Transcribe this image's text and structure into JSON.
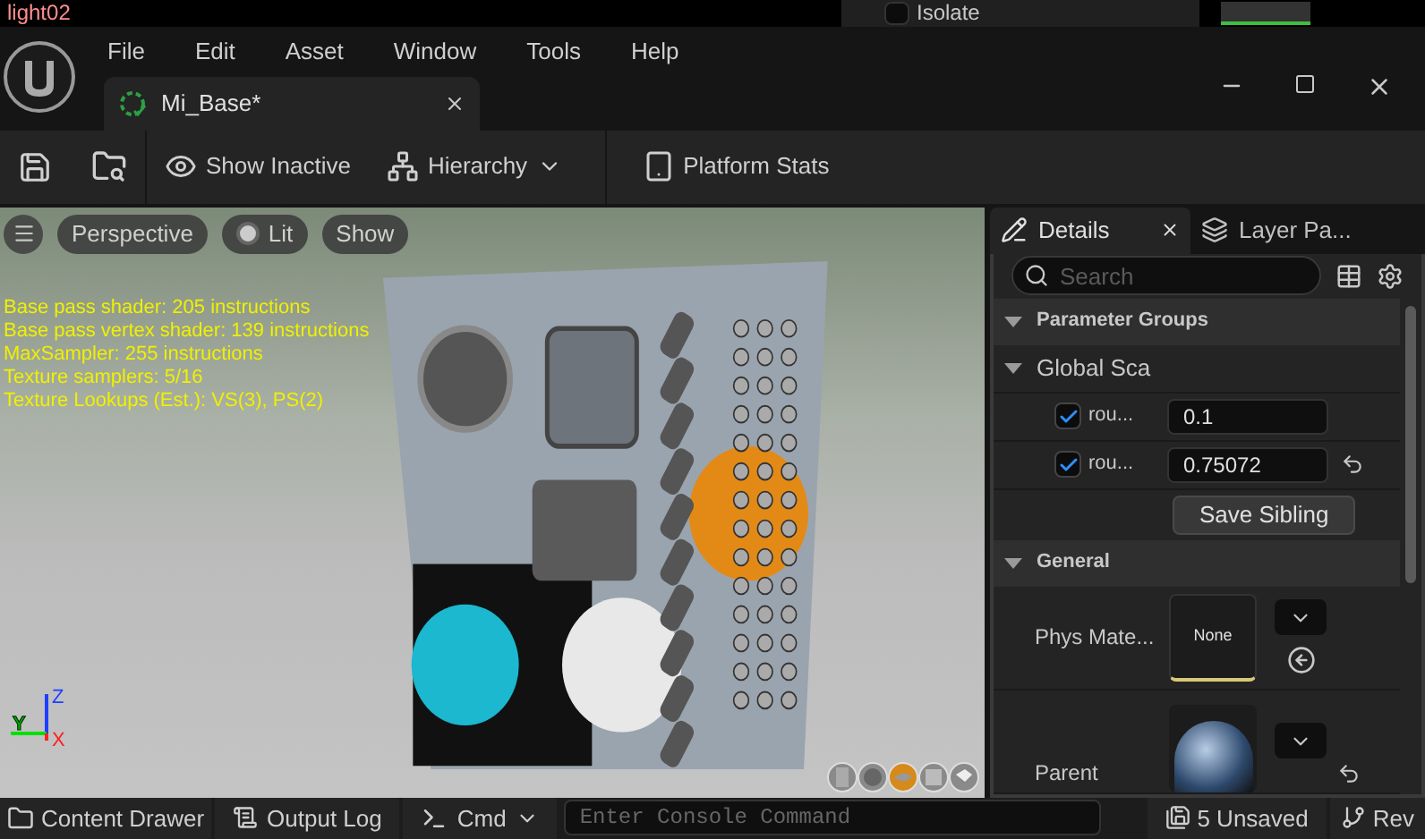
{
  "background_window": {
    "title": "light02",
    "isolate": {
      "label": "Isolate",
      "checked": false
    }
  },
  "menu": [
    "File",
    "Edit",
    "Asset",
    "Window",
    "Tools",
    "Help"
  ],
  "document_tab": {
    "label": "Mi_Base*"
  },
  "toolbar": [
    {
      "kind": "toggle",
      "label": "Show Inactive"
    },
    {
      "kind": "dropdown",
      "label": "Hierarchy"
    },
    {
      "kind": "button",
      "label": "Platform Stats"
    }
  ],
  "viewport": {
    "view_buttons": [
      {
        "kind": "view",
        "label": "Perspective"
      },
      {
        "kind": "lit",
        "label": "Lit"
      },
      {
        "kind": "view",
        "label": "Show"
      }
    ],
    "stats": [
      "Base pass shader: 205 instructions",
      "Base pass vertex shader: 139 instructions",
      "MaxSampler: 255 instructions",
      "Texture samplers: 5/16",
      "Texture Lookups (Est.): VS(3), PS(2)"
    ],
    "axes": {
      "z": "Z",
      "y": "Y",
      "x": "X"
    },
    "preview_shapes": [
      {
        "kind": "cylinder",
        "selected": false
      },
      {
        "kind": "sphere",
        "selected": false
      },
      {
        "kind": "plane",
        "selected": true
      },
      {
        "kind": "cube",
        "selected": false
      },
      {
        "kind": "mesh",
        "selected": false
      }
    ]
  },
  "details": {
    "tabs": [
      {
        "label": "Details",
        "selected": true
      },
      {
        "label": "Layer Pa...",
        "selected": false
      }
    ],
    "search": {
      "placeholder": "Search"
    },
    "parameter_groups": {
      "title": "Parameter Groups",
      "expanded": true,
      "groups": [
        {
          "title": "Global Sca",
          "expanded": true,
          "params": [
            {
              "name": "rou...",
              "checked": true,
              "value": "0.1",
              "reset": false
            },
            {
              "name": "rou...",
              "checked": true,
              "value": "0.75072",
              "reset": true
            }
          ]
        }
      ],
      "save_button": "Save Sibling"
    },
    "general": {
      "title": "General",
      "expanded": true,
      "properties": [
        {
          "kind": "asset",
          "name": "Phys Mate...",
          "asset": "None",
          "reset": false
        },
        {
          "kind": "image",
          "name": "Parent",
          "reset": true
        }
      ]
    }
  },
  "bottom_bar": {
    "content_drawer": "Content Drawer",
    "output_log": "Output Log",
    "cmd": "Cmd",
    "console": {
      "placeholder": "Enter Console Command"
    },
    "unsaved": "5 Unsaved",
    "revision": "Rev"
  }
}
